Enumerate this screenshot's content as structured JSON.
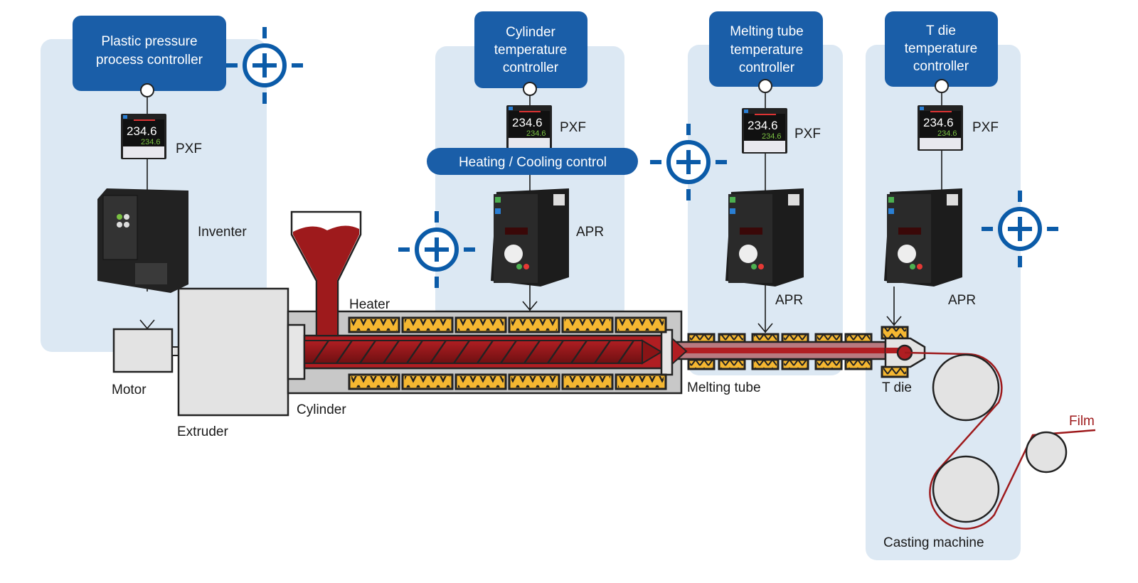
{
  "controllers": [
    {
      "lines": [
        "Plastic pressure",
        "process controller"
      ]
    },
    {
      "lines": [
        "Cylinder",
        "temperature",
        "controller"
      ]
    },
    {
      "lines": [
        "Melting tube",
        "temperature",
        "controller"
      ]
    },
    {
      "lines": [
        "T die",
        "temperature",
        "controller"
      ]
    }
  ],
  "devices": {
    "pxf": "PXF",
    "pxf_display_top": "234.6",
    "pxf_display_bottom": "234.6",
    "apr": "APR",
    "inverter": "Inventer"
  },
  "heating_cooling_label": "Heating / Cooling control",
  "components": {
    "motor": "Motor",
    "extruder": "Extruder",
    "cylinder": "Cylinder",
    "heater": "Heater",
    "melting_tube": "Melting tube",
    "t_die": "T die",
    "film": "Film",
    "casting_machine": "Casting machine"
  },
  "colors": {
    "controller_blue": "#1a5ea8",
    "panel_blue": "#dce8f3",
    "resin_red": "#9e1a1c",
    "heater_yellow": "#f5b731",
    "film_red": "#9e1a1c"
  },
  "icons": [
    "plus-circle-icon"
  ]
}
